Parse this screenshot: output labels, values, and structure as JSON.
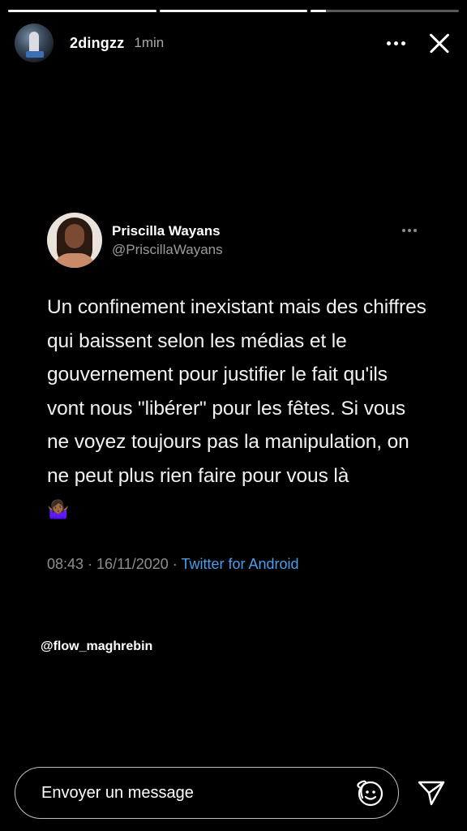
{
  "story": {
    "progress": [
      1.0,
      1.0,
      0.1
    ],
    "user": {
      "username": "2dingzz",
      "time": "1min"
    },
    "icons": {
      "more": "more-horizontal-icon",
      "close": "close-icon"
    }
  },
  "tweet": {
    "name": "Priscilla Wayans",
    "handle": "@PriscillaWayans",
    "text": "Un confinement inexistant mais des chiffres qui baissent selon les médias et le gouvernement pour justifier le fait qu'ils vont nous \"libérer\" pour les fêtes. Si vous ne voyez toujours pas la manipulation, on ne peut plus rien faire pour vous là",
    "emoji": "🤷🏾‍♀️",
    "timestamp": "08:43 · 16/11/2020 · ",
    "source": "Twitter for Android"
  },
  "credit": "@flow_maghrebin",
  "footer": {
    "placeholder": "Envoyer un message",
    "icons": {
      "sticker": "sticker-icon",
      "send": "send-icon"
    }
  },
  "colors": {
    "background": "#000000",
    "link": "#4a9eed"
  }
}
